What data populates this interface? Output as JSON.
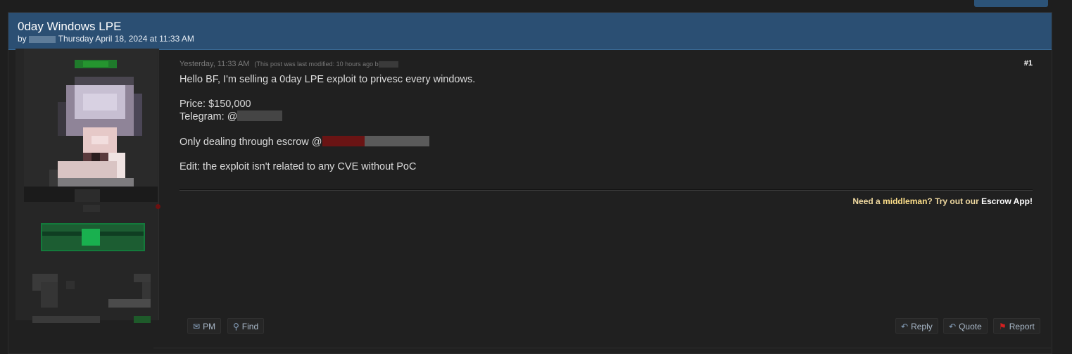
{
  "thread": {
    "title": "0day Windows LPE",
    "by_label": "by",
    "date": "Thursday April 18, 2024 at 11:33 AM"
  },
  "post": {
    "timestamp": "Yesterday, 11:33 AM",
    "edited_note": "(This post was last modified: 10 hours ago b",
    "number": "#1",
    "lines": {
      "intro": "Hello BF, I'm selling a 0day LPE exploit to privesc every windows.",
      "price": "Price: $150,000",
      "telegram": "Telegram: @",
      "escrow": "Only dealing through escrow @",
      "edit": "Edit: the exploit isn't related to any CVE without PoC"
    },
    "signature": {
      "prefix": "Need a ",
      "middleman": "middleman",
      "mid": "? Try out our ",
      "app": "Escrow App!"
    }
  },
  "actions": {
    "pm": "PM",
    "find": "Find",
    "reply": "Reply",
    "quote": "Quote",
    "report": "Report"
  },
  "icons": {
    "pm": "envelope-icon",
    "find": "search-icon",
    "reply": "reply-icon",
    "quote": "quote-icon",
    "report": "flag-icon"
  },
  "colors": {
    "header": "#2b4f73",
    "accent_green": "#19b04f",
    "report_flag": "#d42020"
  }
}
